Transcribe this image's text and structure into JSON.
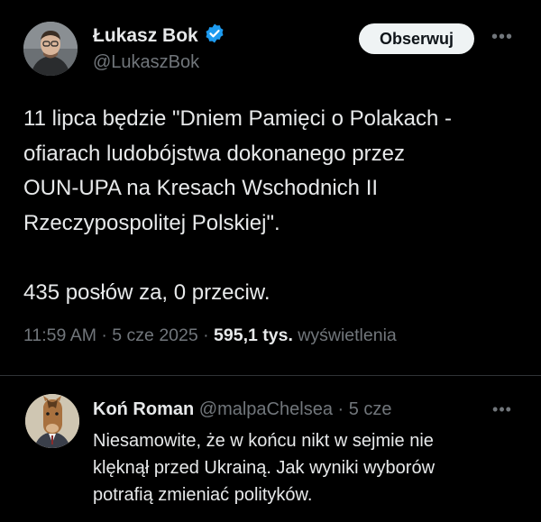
{
  "tweet": {
    "author": {
      "display_name": "Łukasz Bok",
      "handle": "@LukaszBok",
      "verified_icon": "verified-badge-icon",
      "verified_color": "#1d9bf0"
    },
    "follow_label": "Obserwuj",
    "more_icon": "more-dots-icon",
    "text": "11 lipca będzie \"Dniem Pamięci o Polakach -\nofiarach ludobójstwa dokonanego przez\nOUN-UPA na Kresach Wschodnich II\nRzeczypospolitej Polskiej\".\n\n435 posłów za, 0 przeciw.",
    "time": "11:59 AM",
    "separator": "·",
    "date": "5 cze 2025",
    "views_count": "595,1 tys.",
    "views_label": "wyświetlenia"
  },
  "reply": {
    "display_name": "Koń Roman",
    "handle": "@malpaChelsea",
    "separator": "·",
    "date": "5 cze",
    "more_icon": "more-dots-icon",
    "text": "Niesamowite, że w końcu nikt w sejmie nie\nklęknął przed Ukrainą. Jak wyniki wyborów\npotrafią zmieniać polityków."
  },
  "colors": {
    "background": "#000000",
    "text_primary": "#e7e9ea",
    "text_secondary": "#71767b",
    "divider": "#2f3336",
    "follow_bg": "#eff3f4"
  }
}
